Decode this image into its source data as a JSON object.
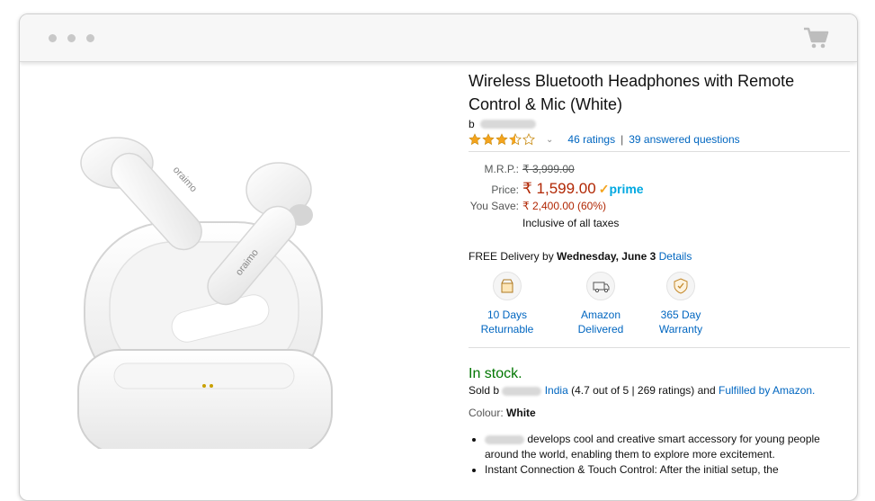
{
  "browser": {
    "dots": [
      "dot-1",
      "dot-2",
      "dot-3"
    ],
    "cart_icon": "shopping-cart-icon"
  },
  "product": {
    "title": "Wireless Bluetooth Headphones with Remote Control & Mic (White)",
    "brand_prefix": "b",
    "rating_stars": 3.5,
    "ratings_link": "46 ratings",
    "separator": "|",
    "answered_link": "39 answered questions",
    "image_logo_text": "oraimo"
  },
  "pricing": {
    "mrp_label": "M.R.P.:",
    "mrp_value": "₹ 3,999.00",
    "price_label": "Price:",
    "price_value": "₹ 1,599.00",
    "prime_label": "prime",
    "save_label": "You Save:",
    "save_value": "₹ 2,400.00 (60%)",
    "tax_note": "Inclusive of all taxes"
  },
  "delivery": {
    "prefix": "FREE Delivery by",
    "date": "Wednesday, June 3",
    "details_link": "Details"
  },
  "features": [
    {
      "icon": "return-box-icon",
      "line1": "10 Days",
      "line2": "Returnable"
    },
    {
      "icon": "delivery-truck-icon",
      "line1": "Amazon",
      "line2": "Delivered"
    },
    {
      "icon": "warranty-shield-icon",
      "line1": "365 Day",
      "line2": "Warranty"
    }
  ],
  "availability": {
    "stock": "In stock.",
    "sold_prefix": "Sold b",
    "seller_suffix": "India",
    "seller_rating": "(4.7 out of 5 | 269 ratings) and",
    "fulfilled_link": "Fulfilled by Amazon."
  },
  "colour": {
    "label": "Colour:",
    "value": "White"
  },
  "bullets": [
    {
      "text": "develops cool and creative smart accessory for young people around the world, enabling them to explore more excitement."
    },
    {
      "text": "Instant Connection & Touch Control: After the initial setup, the"
    }
  ],
  "colors": {
    "link": "#0066c0",
    "price": "#b12704",
    "stock": "#007600",
    "star": "#f4a41d",
    "prime": "#00a8e1"
  }
}
